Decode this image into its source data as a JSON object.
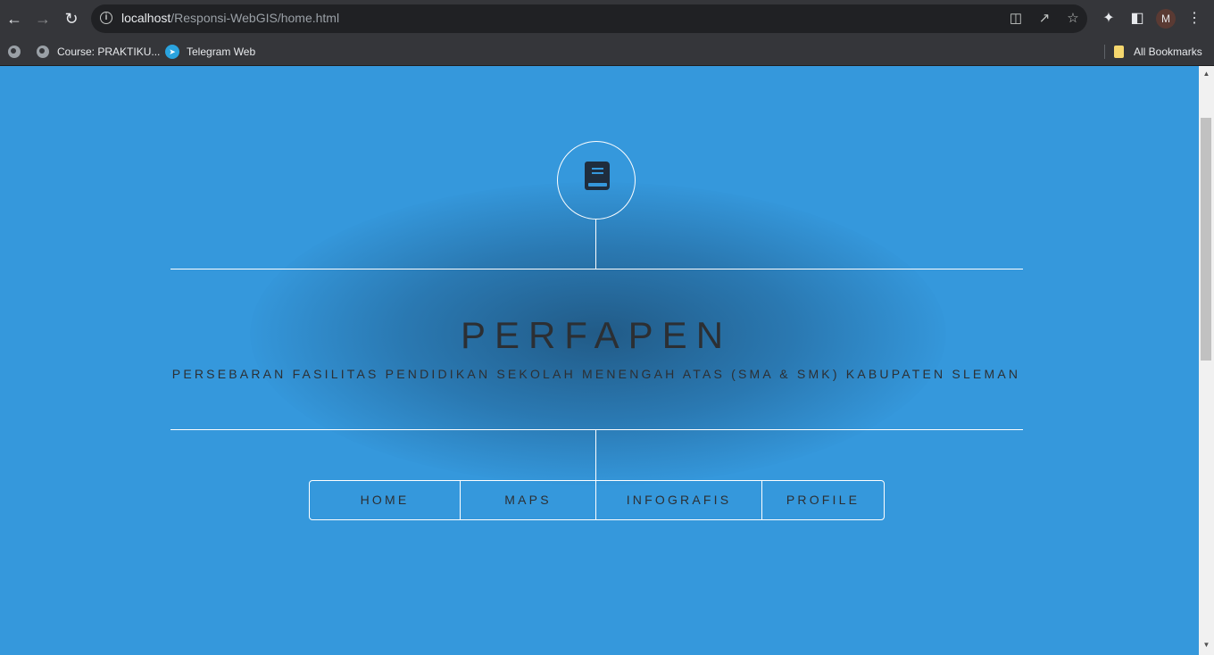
{
  "browser": {
    "url_host": "localhost",
    "url_path": "/Responsi-WebGIS/home.html",
    "profile_initial": "M",
    "bookmarks": [
      {
        "label": "Course: PRAKTIKU...",
        "icon": "globe-icon"
      },
      {
        "label": "Telegram Web",
        "icon": "telegram-icon"
      }
    ],
    "all_bookmarks_label": "All Bookmarks"
  },
  "page": {
    "title": "PERFAPEN",
    "subtitle": "PERSEBARAN FASILITAS PENDIDIKAN SEKOLAH MENENGAH ATAS (SMA & SMK) KABUPATEN SLEMAN",
    "logo_icon": "book-icon",
    "background_color": "#3598dc",
    "text_color": "#2c2f33",
    "nav": [
      {
        "label": "HOME"
      },
      {
        "label": "MAPS"
      },
      {
        "label": "INFOGRAFIS"
      },
      {
        "label": "PROFILE"
      }
    ]
  }
}
